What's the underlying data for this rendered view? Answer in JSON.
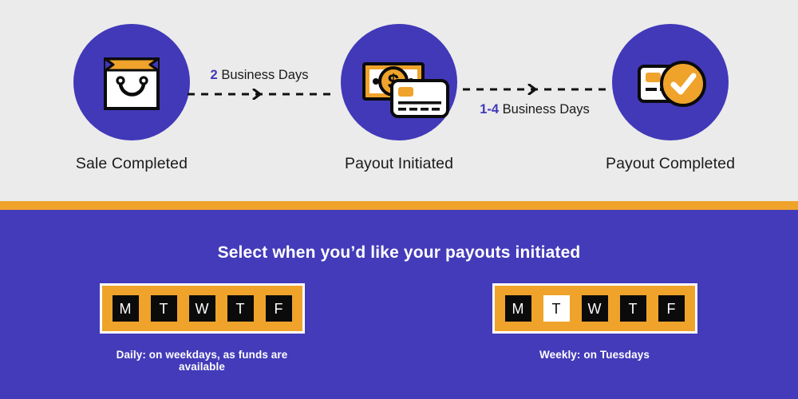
{
  "colors": {
    "background": "#ebebeb",
    "brand_purple": "#4139b8",
    "panel_purple": "#433bb9",
    "accent_orange": "#efa32b",
    "ink": "#1a1a1a",
    "white": "#ffffff",
    "black": "#0b0b0b"
  },
  "timeline": {
    "steps": [
      {
        "label": "Sale Completed",
        "icon": "shopping-bag-icon"
      },
      {
        "label": "Payout Initiated",
        "icon": "cash-and-card-icon"
      },
      {
        "label": "Payout Completed",
        "icon": "card-check-icon"
      }
    ],
    "connectors": [
      {
        "duration": "2",
        "unit": "Business Days",
        "arrow": "chevron-right-icon"
      },
      {
        "duration": "1-4",
        "unit": "Business Days",
        "arrow": "chevron-right-icon"
      }
    ]
  },
  "panel": {
    "heading": "Select when you’d like your payouts initiated",
    "options": [
      {
        "name": "daily",
        "days": [
          {
            "letter": "M",
            "selected": false
          },
          {
            "letter": "T",
            "selected": false
          },
          {
            "letter": "W",
            "selected": false
          },
          {
            "letter": "T",
            "selected": false
          },
          {
            "letter": "F",
            "selected": false
          }
        ],
        "caption": "Daily: on weekdays, as funds are available"
      },
      {
        "name": "weekly",
        "days": [
          {
            "letter": "M",
            "selected": false
          },
          {
            "letter": "T",
            "selected": true
          },
          {
            "letter": "W",
            "selected": false
          },
          {
            "letter": "T",
            "selected": false
          },
          {
            "letter": "F",
            "selected": false
          }
        ],
        "caption": "Weekly: on Tuesdays"
      }
    ]
  }
}
